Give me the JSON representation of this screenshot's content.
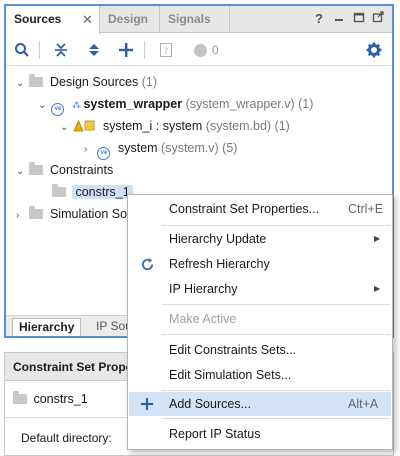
{
  "sources_window": {
    "tabs": [
      {
        "label": "Sources",
        "active": true
      },
      {
        "label": "Design",
        "active": false
      },
      {
        "label": "Signals",
        "active": false
      }
    ],
    "close_glyph": "✕",
    "window_controls": [
      "?",
      "–",
      "□",
      "⧉"
    ],
    "toolbar": {
      "buttons": [
        "search-icon",
        "collapse-all-icon",
        "expand-all-icon",
        "add-icon",
        "help-doc-icon",
        "status-circle-icon",
        "gear-icon"
      ],
      "status_count": "0"
    },
    "tree": {
      "design_sources": {
        "label": "Design Sources",
        "count": "(1)"
      },
      "system_wrapper": {
        "name": "system_wrapper",
        "detail": "(system_wrapper.v) (1)"
      },
      "system_i": {
        "name": "system_i : system",
        "detail": "(system.bd) (1)"
      },
      "system": {
        "name": "system",
        "detail": "(system.v) (5)"
      },
      "constraints": {
        "label": "Constraints"
      },
      "constrs_1": {
        "label": "constrs_1"
      },
      "simulation_sources": {
        "label": "Simulation So"
      }
    },
    "bottom_tabs": [
      "Hierarchy",
      "IP Sou"
    ]
  },
  "properties_panel": {
    "title": "Constraint Set Prope",
    "item": "constrs_1",
    "default_directory_label": "Default directory:"
  },
  "context_menu": {
    "items": [
      {
        "label": "Constraint Set Properties...",
        "shortcut": "Ctrl+E"
      },
      {
        "label": "Hierarchy Update",
        "submenu": "▶"
      },
      {
        "label": "Refresh Hierarchy",
        "icon": "refresh-icon"
      },
      {
        "label": "IP Hierarchy",
        "submenu": "▶"
      },
      {
        "label": "Make Active",
        "disabled": true
      },
      {
        "label": "Edit Constraints Sets..."
      },
      {
        "label": "Edit Simulation Sets..."
      },
      {
        "label": "Add Sources...",
        "shortcut": "Alt+A",
        "icon": "add-icon",
        "highlighted": true
      },
      {
        "label": "Report IP Status"
      }
    ]
  },
  "colors": {
    "accent_blue": "#3a7bd5",
    "window_border": "#5a8fd6",
    "selection": "#cfe0f7",
    "menu_highlight": "#d3e3f8"
  }
}
